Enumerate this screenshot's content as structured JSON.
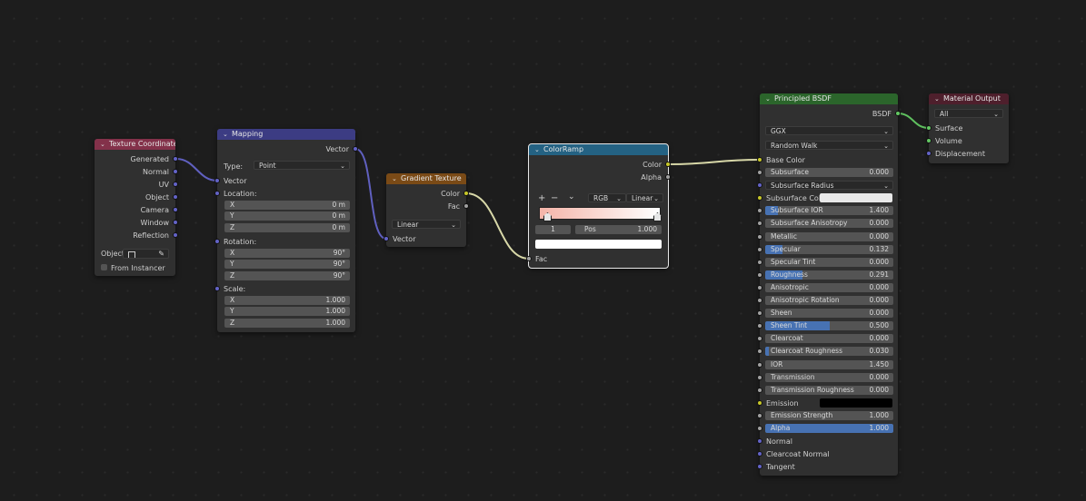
{
  "colors": {
    "input_header": "#83314a",
    "vector_header": "#3c3c83",
    "texture_header": "#7a4a16",
    "converter_header": "#246283",
    "shader_header": "#2b652b",
    "output_header": "#4e1f2c",
    "wire": "#b6b0d8"
  },
  "texture_coordinate": {
    "title": "Texture Coordinate",
    "outputs": [
      "Generated",
      "Normal",
      "UV",
      "Object",
      "Camera",
      "Window",
      "Reflection"
    ],
    "object_label": "Object:",
    "from_instancer": "From Instancer"
  },
  "mapping": {
    "title": "Mapping",
    "output": "Vector",
    "type_label": "Type:",
    "type_value": "Point",
    "vector_label": "Vector",
    "location_label": "Location:",
    "location": [
      {
        "axis": "X",
        "value": "0 m"
      },
      {
        "axis": "Y",
        "value": "0 m"
      },
      {
        "axis": "Z",
        "value": "0 m"
      }
    ],
    "rotation_label": "Rotation:",
    "rotation": [
      {
        "axis": "X",
        "value": "90°"
      },
      {
        "axis": "Y",
        "value": "90°"
      },
      {
        "axis": "Z",
        "value": "90°"
      }
    ],
    "scale_label": "Scale:",
    "scale": [
      {
        "axis": "X",
        "value": "1.000"
      },
      {
        "axis": "Y",
        "value": "1.000"
      },
      {
        "axis": "Z",
        "value": "1.000"
      }
    ]
  },
  "gradient_texture": {
    "title": "Gradient Texture",
    "outputs": [
      "Color",
      "Fac"
    ],
    "type_value": "Linear",
    "input": "Vector"
  },
  "color_ramp": {
    "title": "ColorRamp",
    "outputs": [
      "Color",
      "Alpha"
    ],
    "add": "+",
    "remove": "−",
    "menu": "⌄",
    "color_mode": "RGB",
    "interpolation": "Linear",
    "index": "1",
    "pos_label": "Pos",
    "pos_value": "1.000",
    "input": "Fac"
  },
  "principled": {
    "title": "Principled BSDF",
    "output": "BSDF",
    "distribution": "GGX",
    "subsurface_method": "Random Walk",
    "base_color_label": "Base Color",
    "rows": [
      {
        "label": "Subsurface",
        "value": "0.000",
        "fill": 0
      },
      {
        "label": "Subsurface Radius",
        "kind": "dropdown"
      },
      {
        "label": "Subsurface Color",
        "kind": "color"
      },
      {
        "label": "Subsurface IOR",
        "value": "1.400",
        "fill": 0.1
      },
      {
        "label": "Subsurface Anisotropy",
        "value": "0.000",
        "fill": 0
      },
      {
        "label": "Metallic",
        "value": "0.000",
        "fill": 0
      },
      {
        "label": "Specular",
        "value": "0.132",
        "fill": 0.132
      },
      {
        "label": "Specular Tint",
        "value": "0.000",
        "fill": 0
      },
      {
        "label": "Roughness",
        "value": "0.291",
        "fill": 0.291
      },
      {
        "label": "Anisotropic",
        "value": "0.000",
        "fill": 0
      },
      {
        "label": "Anisotropic Rotation",
        "value": "0.000",
        "fill": 0
      },
      {
        "label": "Sheen",
        "value": "0.000",
        "fill": 0
      },
      {
        "label": "Sheen Tint",
        "value": "0.500",
        "fill": 0.5
      },
      {
        "label": "Clearcoat",
        "value": "0.000",
        "fill": 0
      },
      {
        "label": "Clearcoat Roughness",
        "value": "0.030",
        "fill": 0.03
      },
      {
        "label": "IOR",
        "value": "1.450",
        "fill": 0
      },
      {
        "label": "Transmission",
        "value": "0.000",
        "fill": 0
      },
      {
        "label": "Transmission Roughness",
        "value": "0.000",
        "fill": 0
      },
      {
        "label": "Emission",
        "kind": "color_black"
      },
      {
        "label": "Emission Strength",
        "value": "1.000",
        "fill": 0
      },
      {
        "label": "Alpha",
        "value": "1.000",
        "fill": 1
      }
    ],
    "vector_inputs": [
      "Normal",
      "Clearcoat Normal",
      "Tangent"
    ]
  },
  "material_output": {
    "title": "Material Output",
    "target": "All",
    "inputs": [
      "Surface",
      "Volume",
      "Displacement"
    ]
  }
}
